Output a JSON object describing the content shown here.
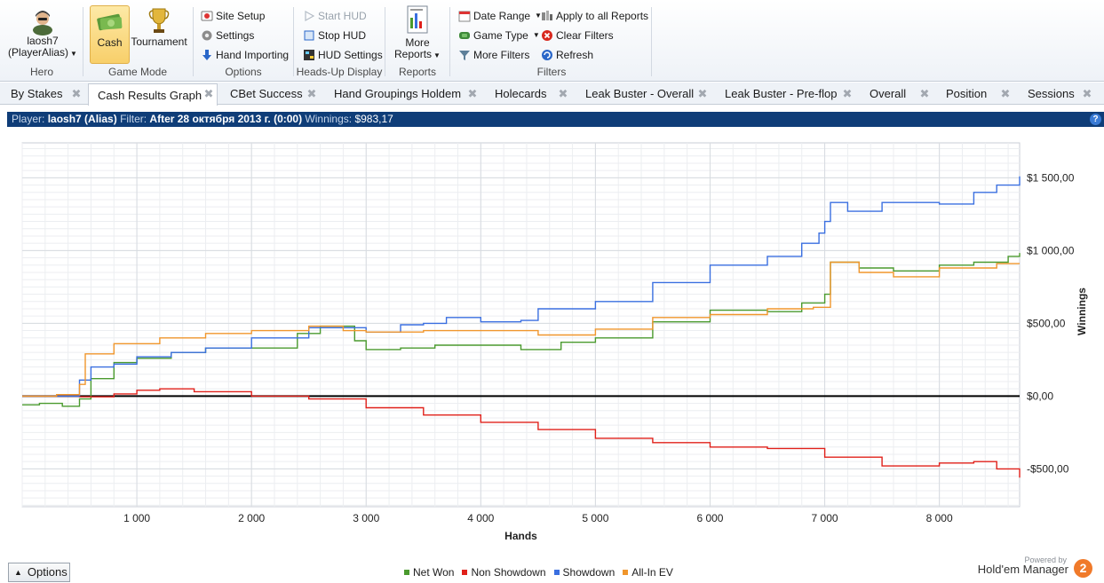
{
  "ribbon": {
    "hero": {
      "name": "laosh7",
      "alias": "(PlayerAlias)",
      "group": "Hero"
    },
    "game_mode": {
      "cash": "Cash",
      "tournament": "Tournament",
      "group": "Game Mode"
    },
    "options": {
      "site_setup": "Site Setup",
      "settings": "Settings",
      "hand_importing": "Hand Importing",
      "group": "Options"
    },
    "hud": {
      "start": "Start HUD",
      "stop": "Stop HUD",
      "settings": "HUD Settings",
      "group": "Heads-Up Display"
    },
    "reports": {
      "more_line1": "More",
      "more_line2": "Reports",
      "group": "Reports"
    },
    "filters": {
      "date_range": "Date Range",
      "game_type": "Game Type",
      "more_filters": "More Filters",
      "apply_all": "Apply to all Reports",
      "clear": "Clear Filters",
      "refresh": "Refresh",
      "group": "Filters"
    }
  },
  "tabs": [
    "By Stakes",
    "Cash Results Graph",
    "CBet Success",
    "Hand Groupings Holdem",
    "Holecards",
    "Leak Buster - Overall",
    "Leak Buster - Pre-flop",
    "Overall",
    "Position",
    "Sessions"
  ],
  "active_tab": 1,
  "infobar": {
    "player_label": "Player:",
    "player": "laosh7 (Alias)",
    "filter_label": "Filter:",
    "filter": "After 28 октября 2013 г. (0:00)",
    "winnings_label": "Winnings:",
    "winnings": "$983,17"
  },
  "chart_data": {
    "type": "line",
    "xlabel": "Hands",
    "ylabel": "Winnings",
    "xlim": [
      0,
      8700
    ],
    "ylim": [
      -760,
      1740
    ],
    "x_ticks": [
      1000,
      2000,
      3000,
      4000,
      5000,
      6000,
      7000,
      8000
    ],
    "x_tick_labels": [
      "1 000",
      "2 000",
      "3 000",
      "4 000",
      "5 000",
      "6 000",
      "7 000",
      "8 000"
    ],
    "y_ticks": [
      -500,
      0,
      500,
      1000,
      1500
    ],
    "y_tick_labels": [
      "-$500,00",
      "$0,00",
      "$500,00",
      "$1 000,00",
      "$1 500,00"
    ],
    "grid": true,
    "legend_position": "bottom-center",
    "series": [
      {
        "name": "Net Won",
        "color": "#4a9a2e",
        "x": [
          0,
          150,
          350,
          500,
          600,
          800,
          1000,
          1300,
          1600,
          2000,
          2400,
          2600,
          2900,
          3000,
          3300,
          3600,
          4000,
          4350,
          4700,
          5000,
          5500,
          6000,
          6500,
          6800,
          7000,
          7050,
          7300,
          7600,
          8000,
          8300,
          8600,
          8700
        ],
        "values": [
          -60,
          -50,
          -70,
          -20,
          120,
          230,
          260,
          300,
          330,
          330,
          430,
          480,
          380,
          320,
          330,
          350,
          350,
          320,
          370,
          400,
          510,
          590,
          580,
          640,
          700,
          920,
          880,
          860,
          900,
          920,
          960,
          983
        ]
      },
      {
        "name": "Non Showdown",
        "color": "#e0201a",
        "x": [
          0,
          500,
          800,
          1000,
          1200,
          1500,
          2000,
          2500,
          3000,
          3500,
          4000,
          4500,
          5000,
          5500,
          6000,
          6500,
          7000,
          7500,
          8000,
          8300,
          8500,
          8700
        ],
        "values": [
          0,
          -5,
          15,
          40,
          50,
          30,
          0,
          -20,
          -80,
          -130,
          -180,
          -230,
          -290,
          -320,
          -350,
          -360,
          -420,
          -480,
          -460,
          -450,
          -500,
          -560
        ]
      },
      {
        "name": "Showdown",
        "color": "#3a6fe0",
        "x": [
          0,
          400,
          500,
          600,
          800,
          1000,
          1300,
          1600,
          2000,
          2500,
          3000,
          3300,
          3500,
          3700,
          4000,
          4350,
          4500,
          5000,
          5500,
          6000,
          6500,
          6800,
          6950,
          7000,
          7050,
          7200,
          7500,
          8000,
          8300,
          8500,
          8700
        ],
        "values": [
          0,
          0,
          110,
          200,
          220,
          270,
          300,
          330,
          400,
          470,
          440,
          490,
          500,
          540,
          510,
          520,
          600,
          650,
          780,
          900,
          960,
          1050,
          1120,
          1200,
          1330,
          1270,
          1330,
          1320,
          1400,
          1450,
          1510
        ]
      },
      {
        "name": "All-In EV",
        "color": "#f0962c",
        "x": [
          0,
          300,
          500,
          550,
          800,
          1200,
          1600,
          2000,
          2500,
          2800,
          3000,
          3500,
          4000,
          4500,
          5000,
          5500,
          6000,
          6500,
          6900,
          7050,
          7300,
          7600,
          8000,
          8500,
          8700
        ],
        "values": [
          0,
          10,
          80,
          290,
          360,
          400,
          430,
          450,
          480,
          450,
          440,
          450,
          450,
          420,
          460,
          540,
          560,
          600,
          610,
          920,
          850,
          820,
          880,
          910,
          910
        ]
      }
    ],
    "baseline": {
      "value": 0,
      "color": "#000000"
    }
  },
  "bottom": {
    "options": "Options",
    "powered_by": "Powered by",
    "product": "Hold'em Manager",
    "badge": "2"
  }
}
